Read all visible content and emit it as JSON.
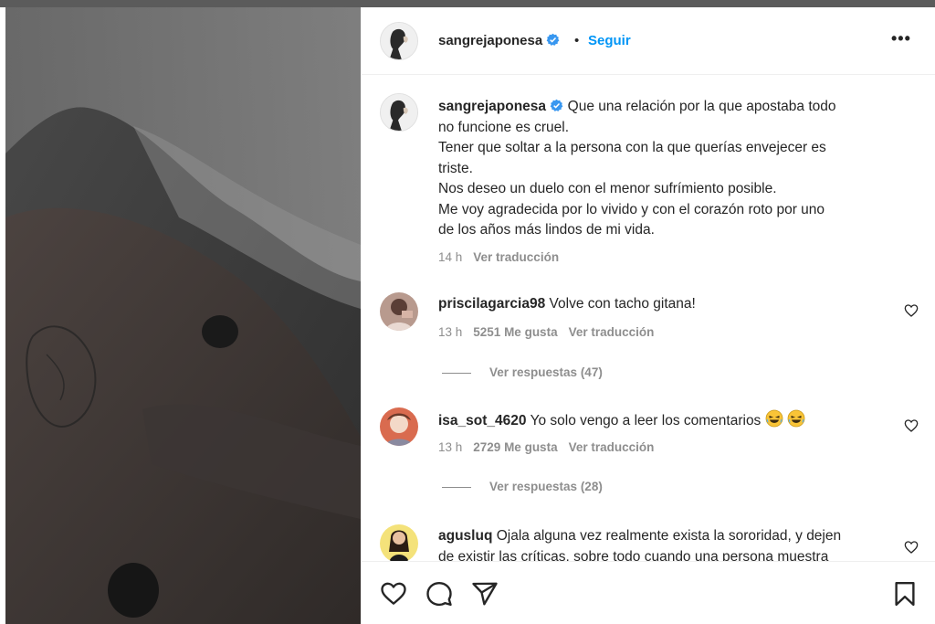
{
  "post": {
    "username": "sangrejaponesa",
    "follow_label": "Seguir",
    "separator": "•",
    "more_label": "•••"
  },
  "caption": {
    "username": "sangrejaponesa",
    "text_lines": [
      "Que una relación por la que apostaba todo",
      "no funcione es cruel.",
      "Tener que soltar a la persona con la que querías envejecer es",
      "triste.",
      "Nos deseo un duelo con el menor sufrímiento posible.",
      "Me voy agradecida por lo vivido y con el corazón roto por uno",
      "de los años más lindos de mi vida."
    ],
    "time": "14 h",
    "translate_label": "Ver traducción"
  },
  "comments": [
    {
      "username": "priscilagarcia98",
      "text": "Volve con tacho gitana!",
      "time": "13 h",
      "likes": "5251 Me gusta",
      "translate_label": "Ver traducción",
      "replies_label": "Ver respuestas (47)"
    },
    {
      "username": "isa_sot_4620",
      "text": "Yo solo vengo a leer los comentarios",
      "emoji": "😂😂",
      "time": "13 h",
      "likes": "2729 Me gusta",
      "translate_label": "Ver traducción",
      "replies_label": "Ver respuestas (28)"
    },
    {
      "username": "agusluq",
      "text_line1": "Ojala alguna vez realmente exista la sororidad, y dejen",
      "text_line2": "de existir las críticas, sobre todo cuando una persona muestra"
    }
  ],
  "icons": {
    "like": "heart-icon",
    "comment": "comment-icon",
    "share": "paper-plane-icon",
    "save": "bookmark-icon",
    "verified": "verified-badge-icon",
    "more": "more-options-icon"
  },
  "colors": {
    "accent": "#0095f6",
    "text": "#262626",
    "secondary": "#8e8e8e",
    "verified": "#3897f0"
  }
}
